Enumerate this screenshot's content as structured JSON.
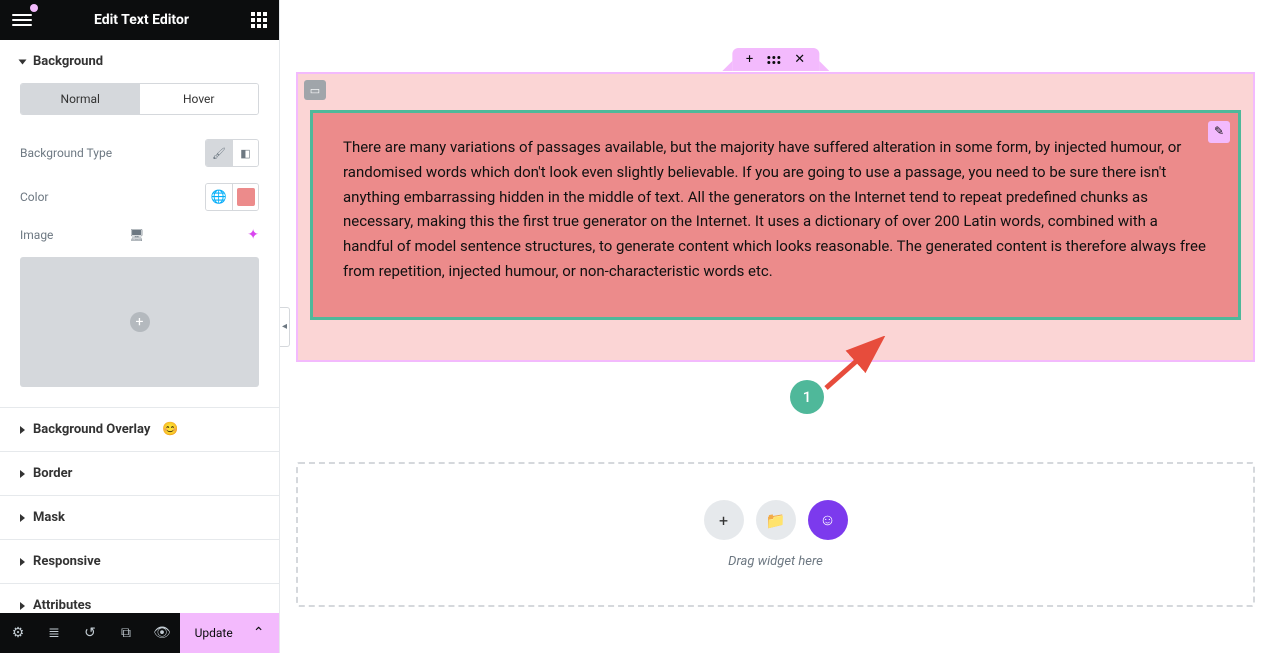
{
  "header": {
    "title": "Edit Text Editor"
  },
  "sidebar": {
    "sections": {
      "background": {
        "label": "Background",
        "tabs": {
          "normal": "Normal",
          "hover": "Hover"
        },
        "bg_type_label": "Background Type",
        "color_label": "Color",
        "image_label": "Image"
      },
      "bg_overlay": "Background Overlay",
      "border": "Border",
      "mask": "Mask",
      "responsive": "Responsive",
      "attributes": "Attributes"
    },
    "footer": {
      "update": "Update"
    }
  },
  "canvas": {
    "text_content": "There are many variations of passages available, but the majority have suffered alteration in some form, by injected humour, or randomised words which don't look even slightly believable. If you are going to use a passage, you need to be sure there isn't anything embarrassing hidden in the middle of text. All the generators on the Internet tend to repeat predefined chunks as necessary, making this the first true generator on the Internet. It uses a dictionary of over 200 Latin words, combined with a handful of model sentence structures, to generate content which looks reasonable. The generated content is therefore always free from repetition, injected humour, or non-characteristic words etc.",
    "drop_text": "Drag widget here",
    "annotation_number": "1"
  },
  "colors": {
    "widget_bg": "#ec8b8b",
    "widget_border": "#4fb89a",
    "container_border": "#f3bafd",
    "container_bg": "#fbd5d5",
    "accent": "#7c3aed"
  }
}
